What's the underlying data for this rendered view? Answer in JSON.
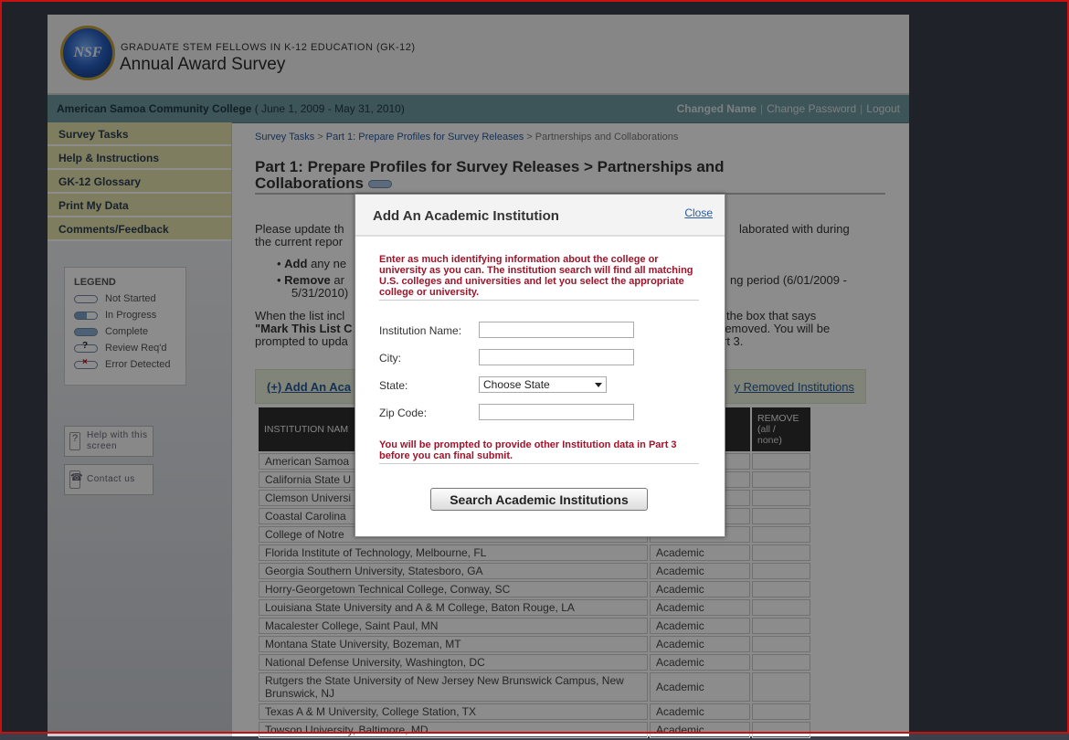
{
  "header": {
    "logo_text": "NSF",
    "program_title": "GRADUATE STEM FELLOWS IN K-12 EDUCATION (GK-12)",
    "app_title": "Annual Award Survey"
  },
  "infobar": {
    "org_name": "American Samoa Community College",
    "period": "( June 1, 2009 - May 31, 2010)",
    "user_name": "Changed Name",
    "change_password": "Change Password",
    "logout": "Logout"
  },
  "sidebar": {
    "items": [
      {
        "label": "Survey Tasks"
      },
      {
        "label": "Help & Instructions"
      },
      {
        "label": "GK-12 Glossary"
      },
      {
        "label": "Print My Data"
      },
      {
        "label": "Comments/Feedback"
      }
    ],
    "legend": {
      "title": "LEGEND",
      "rows": [
        {
          "label": "Not Started"
        },
        {
          "label": "In Progress"
        },
        {
          "label": "Complete"
        },
        {
          "label": "Review Req'd"
        },
        {
          "label": "Error Detected"
        }
      ]
    },
    "help_screen": "Help with this screen",
    "contact_us": "Contact us"
  },
  "main": {
    "breadcrumb": {
      "c1": "Survey Tasks",
      "c2": "Part 1: Prepare Profiles for Survey Releases",
      "c3": "Partnerships and Collaborations",
      "sep": ">"
    },
    "title_line1": "Part 1: Prepare Profiles for Survey Releases > Partnerships and",
    "title_line2": "Collaborations",
    "para_l1_left": "Please update th",
    "para_l1_right": "laborated with during",
    "para_l2": "the current repor",
    "bullet1_bold": "Add",
    "bullet1_rest": "any ne",
    "bullet2_bold": "Remove",
    "bullet2_rest": "ar",
    "bullet2_right": "ng period (6/01/2009 -",
    "bullet2_l2": "5/31/2010)",
    "para2_l1_left": "When the list incl",
    "para2_l1_right": "the box that says",
    "para2_l2_left": "\"Mark This List C",
    "para2_l2_right": "removed. You will be",
    "para2_l3_left": "prompted to upda",
    "para2_l3_right": "rt 3.",
    "add_link": "(+) Add An Aca",
    "removed_link": "y Removed Institutions",
    "table": {
      "headers": [
        "INSTITUTION NAM",
        "",
        "REMOVE"
      ],
      "remove_all": "all",
      "remove_none": "none",
      "rows": [
        {
          "name": "American Samoa",
          "type": ""
        },
        {
          "name": "California State U",
          "type": ""
        },
        {
          "name": "Clemson Universi",
          "type": ""
        },
        {
          "name": "Coastal Carolina",
          "type": ""
        },
        {
          "name": "College of Notre",
          "type": ""
        },
        {
          "name": "Florida Institute of Technology, Melbourne, FL",
          "type": "Academic"
        },
        {
          "name": "Georgia Southern University, Statesboro, GA",
          "type": "Academic"
        },
        {
          "name": "Horry-Georgetown Technical College, Conway, SC",
          "type": "Academic"
        },
        {
          "name": "Louisiana State University and A & M College, Baton Rouge, LA",
          "type": "Academic"
        },
        {
          "name": "Macalester College, Saint Paul, MN",
          "type": "Academic"
        },
        {
          "name": "Montana State University, Bozeman, MT",
          "type": "Academic"
        },
        {
          "name": "National Defense University, Washington, DC",
          "type": "Academic"
        },
        {
          "name": "Rutgers the State University of New Jersey New Brunswick Campus, New Brunswick, NJ",
          "type": "Academic"
        },
        {
          "name": "Texas A & M University, College Station, TX",
          "type": "Academic"
        },
        {
          "name": "Towson University, Baltimore, MD",
          "type": "Academic"
        }
      ]
    }
  },
  "modal": {
    "title": "Add An Academic Institution",
    "close": "Close",
    "intro": "Enter as much identifying information about the college or university as you can. The institution search will find all matching U.S. colleges and universities and let you select the appropriate college or university.",
    "institution_name_label": "Institution Name:",
    "institution_name_value": "",
    "city_label": "City:",
    "city_value": "",
    "state_label": "State:",
    "state_selected": "Choose State",
    "zip_label": "Zip Code:",
    "zip_value": "",
    "footnote": "You will be prompted to provide other Institution data in Part 3 before you can final submit.",
    "search_button": "Search Academic Institutions"
  },
  "colors": {
    "accent_blue": "#2a5a9a",
    "alert_red": "#a0142a",
    "infobar_teal": "#6f9aa3",
    "nav_yellow": "#e8e4b0"
  }
}
